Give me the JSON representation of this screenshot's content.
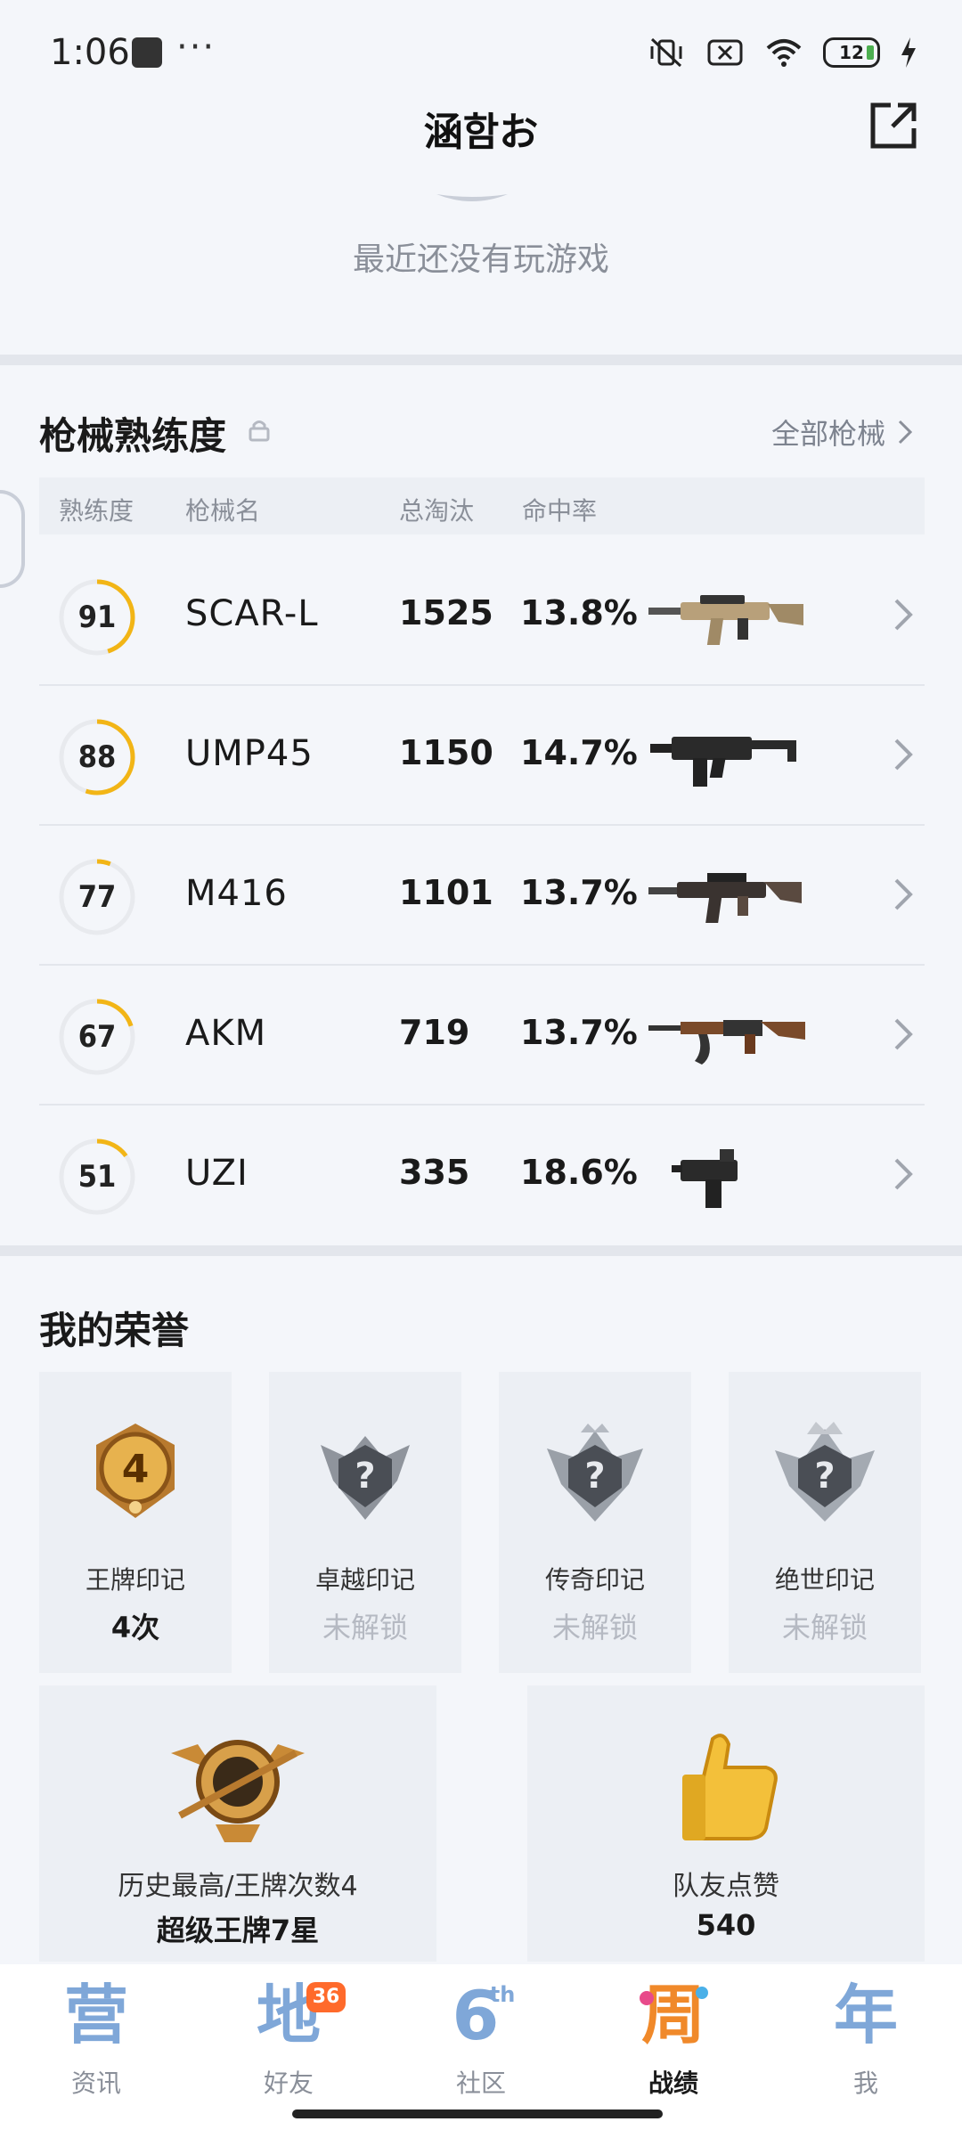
{
  "status": {
    "time": "1:06",
    "battery": "12",
    "wifi_sub": "6"
  },
  "header": {
    "title": "涵함お"
  },
  "recent": {
    "empty_text": "最近还没有玩游戏"
  },
  "weapons": {
    "title": "枪械熟练度",
    "all_link": "全部枪械",
    "columns": {
      "proficiency": "熟练度",
      "name": "枪械名",
      "kills": "总淘汰",
      "accuracy": "命中率"
    },
    "rows": [
      {
        "level": "91",
        "name": "SCAR-L",
        "kills": "1525",
        "accuracy": "13.8%",
        "progress": 0.45
      },
      {
        "level": "88",
        "name": "UMP45",
        "kills": "1150",
        "accuracy": "14.7%",
        "progress": 0.55
      },
      {
        "level": "77",
        "name": "M416",
        "kills": "1101",
        "accuracy": "13.7%",
        "progress": 0.06
      },
      {
        "level": "67",
        "name": "AKM",
        "kills": "719",
        "accuracy": "13.7%",
        "progress": 0.2
      },
      {
        "level": "51",
        "name": "UZI",
        "kills": "335",
        "accuracy": "18.6%",
        "progress": 0.15
      }
    ]
  },
  "honors": {
    "title": "我的荣誉",
    "badges": [
      {
        "label": "王牌印记",
        "value": "4次",
        "unlocked": true,
        "icon": "ace-badge-icon"
      },
      {
        "label": "卓越印记",
        "value": "未解锁",
        "unlocked": false,
        "icon": "locked-badge-icon"
      },
      {
        "label": "传奇印记",
        "value": "未解锁",
        "unlocked": false,
        "icon": "locked-badge-icon"
      },
      {
        "label": "绝世印记",
        "value": "未解锁",
        "unlocked": false,
        "icon": "locked-badge-icon"
      }
    ],
    "highest": {
      "label": "历史最高/王牌次数4",
      "value": "超级王牌7星"
    },
    "likes": {
      "label": "队友点赞",
      "value": "540"
    }
  },
  "nav": {
    "items": [
      {
        "label": "资讯",
        "glyph": "营",
        "active": false
      },
      {
        "label": "好友",
        "glyph": "地",
        "active": false,
        "badge": "36"
      },
      {
        "label": "社区",
        "glyph": "6",
        "sup": "th",
        "active": false
      },
      {
        "label": "战绩",
        "glyph": "周",
        "active": true
      },
      {
        "label": "我",
        "glyph": "年",
        "active": false
      }
    ]
  },
  "colors": {
    "ring_progress": "#f2b516",
    "ring_track": "#e8eaee",
    "nav_icon": "#7fa7d8",
    "nav_active": "#f0892a",
    "badge": "#ff6a2b"
  }
}
